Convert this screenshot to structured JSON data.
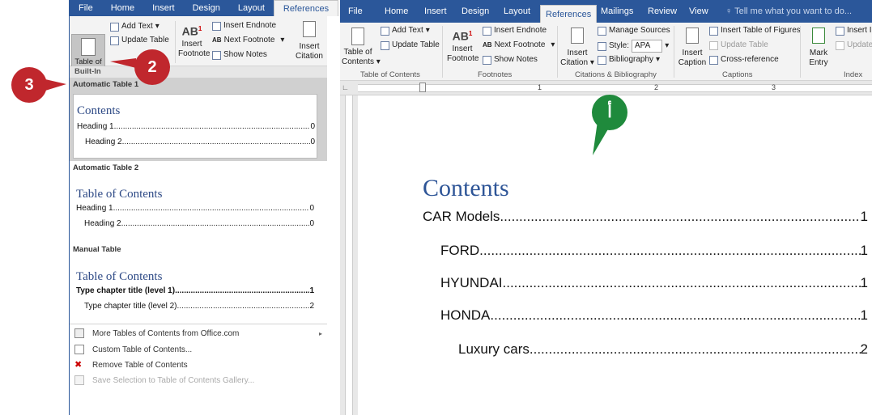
{
  "left": {
    "tabs": [
      "File",
      "Home",
      "Insert",
      "Design",
      "Layout",
      "References"
    ],
    "ribbon": {
      "toc_button": "Table of\nContents",
      "add_text": "Add Text",
      "update_table": "Update Table",
      "insert_footnote": "Insert\nFootnote",
      "insert_endnote": "Insert Endnote",
      "next_footnote": "Next Footnote",
      "show_notes": "Show Notes",
      "insert_citation": "Insert\nCitation",
      "ab_label": "AB"
    },
    "builtin_label": "Built-In",
    "galleries": [
      {
        "label": "Automatic Table 1",
        "heading": "Contents",
        "lines": [
          {
            "text": "Heading 1",
            "page": "0"
          },
          {
            "text": "Heading 2",
            "page": "0"
          }
        ]
      },
      {
        "label": "Automatic Table 2",
        "heading": "Table of Contents",
        "lines": [
          {
            "text": "Heading 1",
            "page": "0"
          },
          {
            "text": "Heading 2",
            "page": "0"
          }
        ]
      },
      {
        "label": "Manual Table",
        "heading": "Table of Contents",
        "lines": [
          {
            "text": "Type chapter title (level 1)",
            "page": "1"
          },
          {
            "text": "Type chapter title (level 2)",
            "page": "2"
          }
        ]
      }
    ],
    "menu": [
      {
        "label": "More Tables of Contents from Office.com",
        "underline": "M",
        "disabled": false
      },
      {
        "label": "Custom Table of Contents...",
        "underline": "C",
        "disabled": false
      },
      {
        "label": "Remove Table of Contents",
        "underline": "R",
        "disabled": false
      },
      {
        "label": "Save Selection to Table of Contents Gallery...",
        "underline": "S",
        "disabled": true
      }
    ]
  },
  "right": {
    "tabs": [
      "File",
      "Home",
      "Insert",
      "Design",
      "Layout",
      "References",
      "Mailings",
      "Review",
      "View"
    ],
    "tell_me": "Tell me what you want to do...",
    "ribbon": {
      "toc_button": "Table of\nContents",
      "add_text": "Add Text",
      "update_table": "Update Table",
      "insert_footnote": "Insert\nFootnote",
      "insert_endnote": "Insert Endnote",
      "next_footnote": "Next Footnote",
      "show_notes": "Show Notes",
      "insert_citation": "Insert\nCitation",
      "manage_sources": "Manage Sources",
      "style_label": "Style:",
      "style_value": "APA",
      "bibliography": "Bibliography",
      "insert_caption": "Insert\nCaption",
      "insert_table_of_figures": "Insert Table of Figures",
      "update_table_fig": "Update Table",
      "cross_reference": "Cross-reference",
      "mark_entry": "Mark\nEntry",
      "insert_index": "Insert In",
      "update_index": "Update",
      "ab_label": "AB"
    },
    "groups": [
      "Table of Contents",
      "Footnotes",
      "Citations & Bibliography",
      "Captions",
      "Index"
    ],
    "ruler_numbers": [
      "1",
      "2",
      "3"
    ],
    "document": {
      "title": "Contents",
      "entries": [
        {
          "text": "CAR Models",
          "page": "1",
          "level": 1
        },
        {
          "text": "FORD",
          "page": "1",
          "level": 2
        },
        {
          "text": "HYUNDAI",
          "page": "1",
          "level": 2
        },
        {
          "text": "HONDA",
          "page": "1",
          "level": 2
        },
        {
          "text": "Luxury cars",
          "page": "2",
          "level": 3
        }
      ]
    }
  },
  "callouts": {
    "c1": "3",
    "c2": "2",
    "c3": "أ"
  },
  "colors": {
    "word_blue": "#2b579a",
    "callout_red": "#c0272d",
    "callout_green": "#1f8a3c",
    "heading_blue": "#2e5597"
  }
}
